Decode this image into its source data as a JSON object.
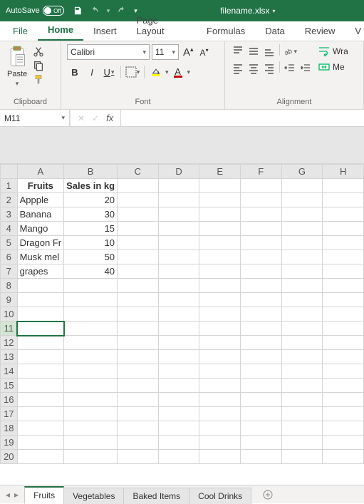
{
  "titlebar": {
    "autosave_label": "AutoSave",
    "autosave_state": "Off",
    "filename": "filename.xlsx"
  },
  "ribbon_tabs": {
    "file": "File",
    "home": "Home",
    "insert": "Insert",
    "page_layout": "Page Layout",
    "formulas": "Formulas",
    "data": "Data",
    "review": "Review",
    "view_initial": "V"
  },
  "ribbon": {
    "clipboard": {
      "label": "Clipboard",
      "paste": "Paste"
    },
    "font": {
      "label": "Font",
      "name": "Calibri",
      "size": "11",
      "increase": "A",
      "decrease": "A",
      "bold": "B",
      "italic": "I",
      "underline": "U",
      "font_color_bar": "#c00000",
      "fill_color_bar": "#ffff00"
    },
    "alignment": {
      "label": "Alignment",
      "wrap": "Wra",
      "merge": "Me"
    }
  },
  "namebox": "M11",
  "fx": "fx",
  "columns": [
    "A",
    "B",
    "C",
    "D",
    "E",
    "F",
    "G",
    "H"
  ],
  "rows_shown": 20,
  "selected_cell": {
    "row": 11,
    "col": "M"
  },
  "data_cells": {
    "header": {
      "A": "Fruits",
      "B": "Sales in kg"
    },
    "rows": [
      {
        "A": "Appple",
        "B": "20"
      },
      {
        "A": "Banana",
        "B": "30"
      },
      {
        "A": "Mango",
        "B": "15"
      },
      {
        "A": "Dragon Fr",
        "B": "10"
      },
      {
        "A": "Musk mel",
        "B": "50"
      },
      {
        "A": "grapes",
        "B": "40"
      }
    ]
  },
  "sheet_tabs": [
    "Fruits",
    "Vegetables",
    "Baked Items",
    "Cool Drinks"
  ],
  "active_sheet": "Fruits",
  "icons": {
    "save": "save-icon",
    "undo": "undo-icon",
    "redo": "redo-icon"
  }
}
